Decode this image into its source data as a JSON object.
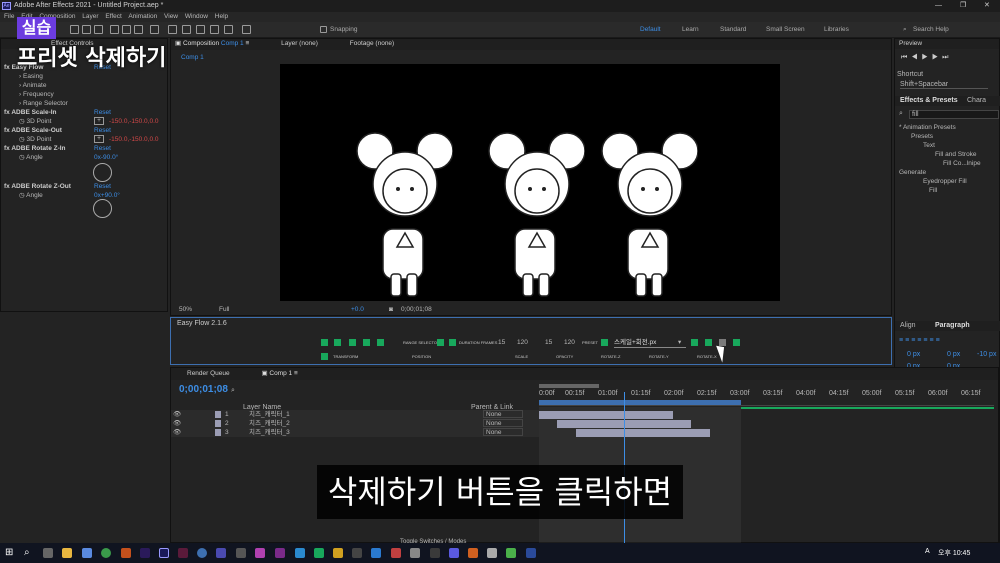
{
  "window": {
    "title": "Adobe After Effects 2021 - Untitled Project.aep *",
    "controls": [
      "—",
      "❐",
      "✕"
    ]
  },
  "menu": [
    "File",
    "Edit",
    "Composition",
    "Layer",
    "Effect",
    "Animation",
    "View",
    "Window",
    "Help"
  ],
  "toolbar": {
    "snapping": "Snapping",
    "workspaces": [
      "Default",
      "Learn",
      "Standard",
      "Small Screen",
      "Libraries"
    ],
    "search_help": "Search Help"
  },
  "overlay": {
    "lesson_badge": "실습",
    "title": "프리셋 삭제하기",
    "subtitle": "삭제하기 버튼을 클릭하면"
  },
  "effect_controls": {
    "header": "Effect Controls",
    "effects": [
      {
        "name": "Easy Flow",
        "reset": "Reset",
        "props": [
          "Easing",
          "Animate",
          "Frequency",
          "Range Selector"
        ]
      },
      {
        "name": "ADBE Scale-In",
        "reset": "Reset",
        "prop": "3D Point",
        "value": "-150.0,-150.0,0.0"
      },
      {
        "name": "ADBE Scale-Out",
        "reset": "Reset",
        "prop": "3D Point",
        "value": "-150.0,-150.0,0.0"
      },
      {
        "name": "ADBE Rotate Z-In",
        "reset": "Reset",
        "prop": "Angle",
        "value": "0x-90.0°"
      },
      {
        "name": "ADBE Rotate Z-Out",
        "reset": "Reset",
        "prop": "Angle",
        "value": "0x+90.0°"
      }
    ]
  },
  "composition": {
    "tab": "Composition",
    "tab_comp": "Comp 1",
    "layer_tab": "Layer (none)",
    "footage_tab": "Footage (none)",
    "comp_crumb": "Comp 1",
    "zoom": "50%",
    "quality": "Full",
    "exposure": "+0.0",
    "timecode": "0;00;01;08"
  },
  "easyflow": {
    "title": "Easy Flow 2.1.6",
    "duration_label": "DURATION FRAMES",
    "num1": "15",
    "num2": "120",
    "num3": "15",
    "num4": "120",
    "preset_label": "PRESET",
    "preset_value": "스케일+회전.px",
    "row2_labels": [
      "TRANSFORM",
      "POSITION",
      "SCALE",
      "OPACITY",
      "ROTATE-Z",
      "ROTATE-Y",
      "ROTATE-X"
    ],
    "range_label": "RANGE SELECTOR"
  },
  "right_panel": {
    "preview": "Preview",
    "shortcut": "Shortcut",
    "shortcut_value": "Shift+Spacebar",
    "fx_tab": "Effects & Presets",
    "char_tab": "Chara",
    "search_value": "fill",
    "tree": [
      "* Animation Presets",
      "Presets",
      "Text",
      "Fill and Stroke",
      "Fill Co...lnipe",
      "Generate",
      "Eyedropper Fill",
      "Fill"
    ],
    "align_tab": "Align",
    "paragraph_tab": "Paragraph",
    "para_values": [
      "0 px",
      "0 px",
      "-10 px",
      "0 px",
      "0 px"
    ]
  },
  "timeline": {
    "render_queue": "Render Queue",
    "comp_tab": "Comp 1",
    "timecode": "0;00;01;08",
    "col_layer": "Layer Name",
    "col_parent": "Parent & Link",
    "layers": [
      {
        "num": "1",
        "name": "치즈_캐릭터_1",
        "parent": "None"
      },
      {
        "num": "2",
        "name": "치즈_캐릭터_2",
        "parent": "None"
      },
      {
        "num": "3",
        "name": "치즈_캐릭터_3",
        "parent": "None"
      }
    ],
    "ruler": [
      "0:00f",
      "00:15f",
      "01:00f",
      "01:15f",
      "02:00f",
      "02:15f",
      "03:00f",
      "03:15f",
      "04:00f",
      "04:15f",
      "05:00f",
      "05:15f",
      "06:00f",
      "06:15f"
    ],
    "toggle": "Toggle Switches / Modes"
  },
  "taskbar": {
    "lang": "A",
    "time": "오후 10:45"
  }
}
